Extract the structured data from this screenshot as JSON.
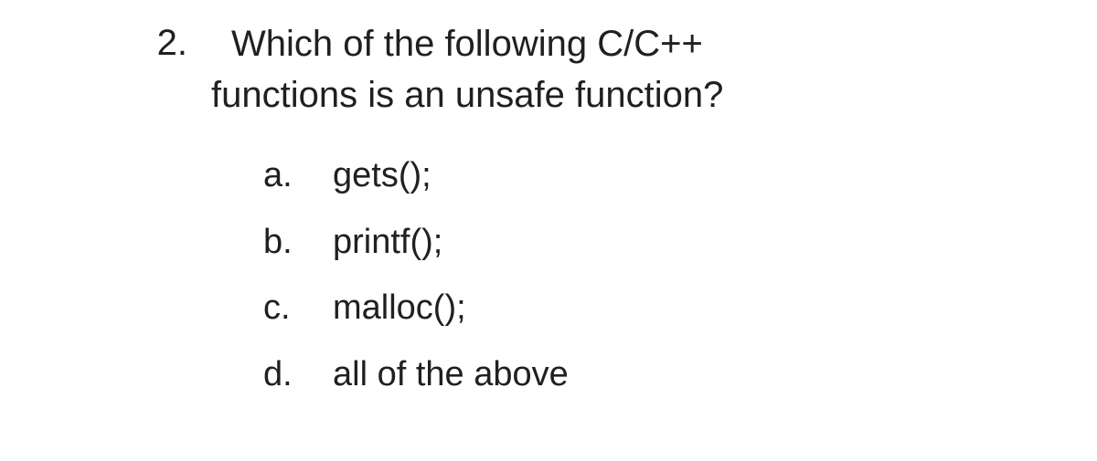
{
  "question": {
    "number": "2.",
    "text_line1": "Which of the following C/C++",
    "text_line2": "functions is an unsafe function?"
  },
  "options": [
    {
      "letter": "a.",
      "text": "gets();"
    },
    {
      "letter": "b.",
      "text": "printf();"
    },
    {
      "letter": "c.",
      "text": "malloc();"
    },
    {
      "letter": "d.",
      "text": "all of the above"
    }
  ]
}
